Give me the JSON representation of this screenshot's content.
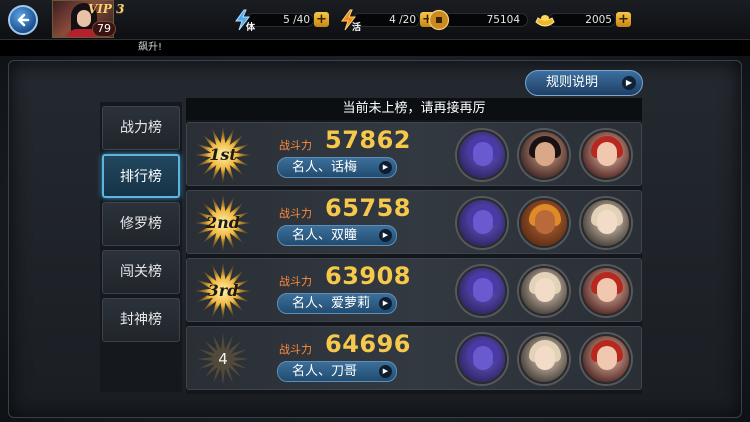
{
  "player": {
    "vip": "VIP 3",
    "level": "79"
  },
  "resources": {
    "stamina": {
      "tag": "体",
      "value": "5 /40"
    },
    "energy": {
      "tag": "活",
      "value": "4 /20"
    },
    "coins": {
      "value": "75104"
    },
    "ingots": {
      "value": "2005"
    },
    "plus_label": "+"
  },
  "notice": "飙升!",
  "rules_button": {
    "label": "规则说明",
    "arrow": "▶"
  },
  "tabs": [
    {
      "label": "战力榜",
      "active": false
    },
    {
      "label": "排行榜",
      "active": true
    },
    {
      "label": "修罗榜",
      "active": false
    },
    {
      "label": "闯关榜",
      "active": false
    },
    {
      "label": "封神榜",
      "active": false
    }
  ],
  "list_header": "当前未上榜，请再接再厉",
  "power_label": "战斗力",
  "rankings": [
    {
      "rank": "1st",
      "badge": "star",
      "power": "57862",
      "name": "名人、话梅",
      "heroes": [
        "demon",
        "warrior",
        "redgirl"
      ]
    },
    {
      "rank": "2nd",
      "badge": "star",
      "power": "65758",
      "name": "名人、双瞳",
      "heroes": [
        "demon",
        "beast",
        "blonde"
      ]
    },
    {
      "rank": "3rd",
      "badge": "star",
      "power": "63908",
      "name": "名人、爱萝莉",
      "heroes": [
        "demon",
        "blonde",
        "redgirl"
      ]
    },
    {
      "rank": "4",
      "badge": "plain",
      "power": "64696",
      "name": "名人、刀哥",
      "heroes": [
        "demon",
        "blonde",
        "redgirl"
      ]
    }
  ],
  "colors": {
    "accent_blue": "#5fb4df",
    "gold": "#f6c84b",
    "power_label": "#ff8c3a"
  }
}
